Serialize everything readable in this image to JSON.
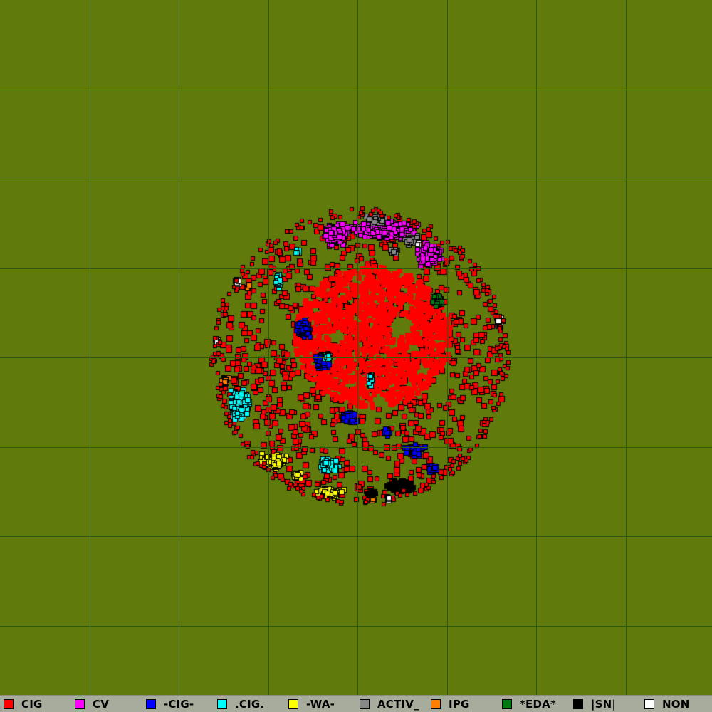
{
  "map": {
    "background_color": "#617a0c",
    "grid_color": "#2e5a10",
    "grid_line_count": 7
  },
  "legend": [
    {
      "label": "CIG",
      "color": "#ff0000",
      "icon": "red-square"
    },
    {
      "label": "CV",
      "color": "#ff00ff",
      "icon": "magenta-square"
    },
    {
      "label": "-CIG-",
      "color": "#0000ff",
      "icon": "blue-square"
    },
    {
      "label": ".CIG.",
      "color": "#00ffff",
      "icon": "cyan-square"
    },
    {
      "label": "-WA-",
      "color": "#ffff00",
      "icon": "yellow-square"
    },
    {
      "label": "ACTIV_",
      "color": "#888888",
      "icon": "gray-square"
    },
    {
      "label": "IPG",
      "color": "#ff8000",
      "icon": "orange-square"
    },
    {
      "label": "*EDA*",
      "color": "#007a10",
      "icon": "green-square"
    },
    {
      "label": "|SN|",
      "color": "#000000",
      "icon": "black-square"
    },
    {
      "label": "NON",
      "color": "#ffffff",
      "icon": "white-square"
    }
  ]
}
